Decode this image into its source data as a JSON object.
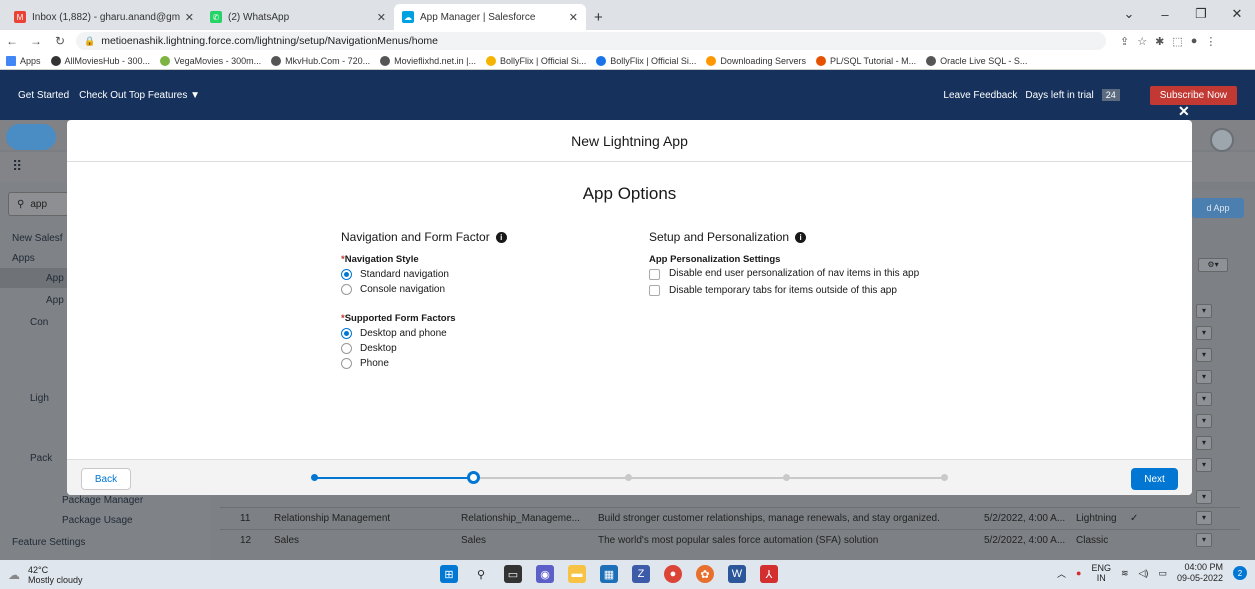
{
  "browser": {
    "tabs": [
      {
        "label": "Inbox (1,882) - gharu.anand@gm",
        "color": "#ea4335",
        "glyph": "M"
      },
      {
        "label": "(2) WhatsApp",
        "color": "#25d366",
        "glyph": "✆"
      },
      {
        "label": "App Manager | Salesforce",
        "color": "#00a1e0",
        "glyph": "☁"
      }
    ],
    "url": "metioenashik.lightning.force.com/lightning/setup/NavigationMenus/home",
    "bookmarks": [
      "Apps",
      "AllMoviesHub - 300...",
      "VegaMovies - 300m...",
      "MkvHub.Com - 720...",
      "Movieflixhd.net.in |...",
      "BollyFlix | Official Si...",
      "BollyFlix | Official Si...",
      "Downloading Servers",
      "PL/SQL Tutorial - M...",
      "Oracle Live SQL - S..."
    ]
  },
  "trialbar": {
    "get_started": "Get Started",
    "check_out": "Check Out Top Features ▼",
    "feedback": "Leave Feedback",
    "days_label": "Days left in trial",
    "days": "24",
    "subscribe": "Subscribe Now"
  },
  "background": {
    "search_value": "app",
    "sidebar": [
      "New Salesf",
      "Apps",
      "App",
      "App",
      "Con",
      "Ligh",
      "Pack",
      "Package Manager",
      "Package Usage",
      "Feature Settings"
    ],
    "right_button": "d App",
    "rows": [
      {
        "num": "11",
        "name": "Relationship Management",
        "dev": "Relationship_Manageme...",
        "desc": "Build stronger customer relationships, manage renewals, and stay organized.",
        "date": "5/2/2022, 4:00 A...",
        "type": "Lightning",
        "check": "✓"
      },
      {
        "num": "12",
        "name": "Sales",
        "dev": "Sales",
        "desc": "The world's most popular sales force automation (SFA) solution",
        "date": "5/2/2022, 4:00 A...",
        "type": "Classic",
        "check": ""
      }
    ]
  },
  "modal": {
    "title": "New Lightning App",
    "subtitle": "App Options",
    "left": {
      "heading": "Navigation and Form Factor",
      "nav_label": "Navigation Style",
      "nav_options": [
        "Standard navigation",
        "Console navigation"
      ],
      "form_label": "Supported Form Factors",
      "form_options": [
        "Desktop and phone",
        "Desktop",
        "Phone"
      ]
    },
    "right": {
      "heading": "Setup and Personalization",
      "settings_label": "App Personalization Settings",
      "check1": "Disable end user personalization of nav items in this app",
      "check2": "Disable temporary tabs for items outside of this app"
    },
    "back": "Back",
    "next": "Next",
    "progress": {
      "steps": 5,
      "current": 2
    }
  },
  "taskbar": {
    "temp": "42°C",
    "weather": "Mostly cloudy",
    "lang": "ENG",
    "region": "IN",
    "time": "04:00 PM",
    "date": "09-05-2022"
  }
}
